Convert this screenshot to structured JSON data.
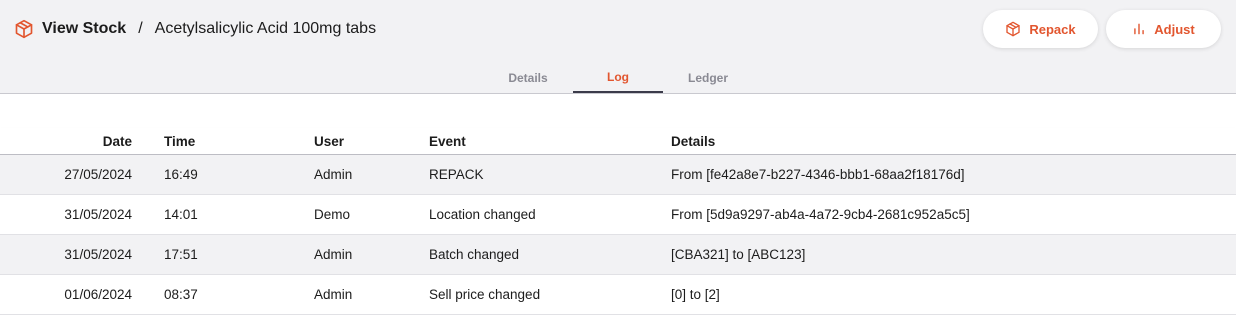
{
  "header": {
    "icon": "package-icon",
    "title": "View Stock",
    "separator": "/",
    "item_name": "Acetylsalicylic Acid 100mg tabs"
  },
  "actions": {
    "repack_label": "Repack",
    "repack_icon": "package-icon",
    "adjust_label": "Adjust",
    "adjust_icon": "bar-chart-icon"
  },
  "tabs": [
    {
      "label": "Details",
      "active": false
    },
    {
      "label": "Log",
      "active": true
    },
    {
      "label": "Ledger",
      "active": false
    }
  ],
  "table": {
    "columns": [
      "Date",
      "Time",
      "User",
      "Event",
      "Details"
    ],
    "rows": [
      {
        "date": "27/05/2024",
        "time": "16:49",
        "user": "Admin",
        "event": "REPACK",
        "details": "From [fe42a8e7-b227-4346-bbb1-68aa2f18176d]"
      },
      {
        "date": "31/05/2024",
        "time": "14:01",
        "user": "Demo",
        "event": "Location changed",
        "details": "From [5d9a9297-ab4a-4a72-9cb4-2681c952a5c5]"
      },
      {
        "date": "31/05/2024",
        "time": "17:51",
        "user": "Admin",
        "event": "Batch changed",
        "details": "[CBA321] to [ABC123]"
      },
      {
        "date": "01/06/2024",
        "time": "08:37",
        "user": "Admin",
        "event": "Sell price changed",
        "details": "[0] to [2]"
      }
    ]
  },
  "colors": {
    "accent": "#e2562f",
    "header_bg": "#f2f2f4",
    "tab_inactive": "#8a8a93",
    "tab_underline": "#3b3b4a"
  }
}
